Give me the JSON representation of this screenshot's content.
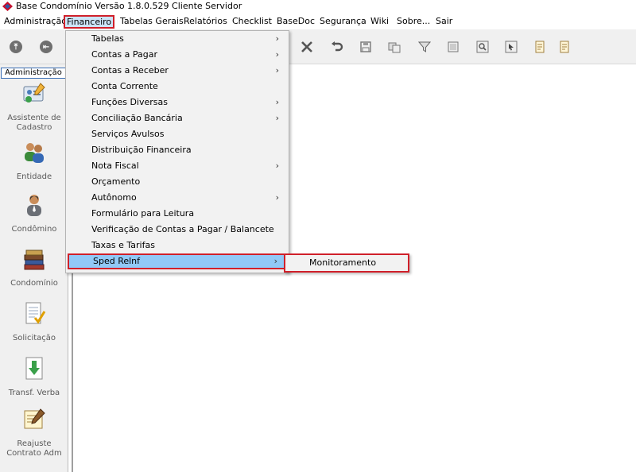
{
  "window": {
    "title": "Base Condomínio Versão 1.8.0.529 Cliente Servidor"
  },
  "menubar": {
    "items": [
      "Administração",
      "Financeiro",
      "Tabelas Gerais",
      "Relatórios",
      "Checklist",
      "BaseDoc",
      "Segurança",
      "Wiki",
      "Sobre...",
      "Sair"
    ]
  },
  "sidebar": {
    "tab": "Administração",
    "items": [
      "Assistente de Cadastro",
      "Entidade",
      "Condômino",
      "Condomínio",
      "Solicitação",
      "Transf. Verba",
      "Reajuste Contrato Adm"
    ]
  },
  "financeiro_menu": {
    "items": [
      "Tabelas",
      "Contas a Pagar",
      "Contas a Receber",
      "Conta Corrente",
      "Funções Diversas",
      "Conciliação Bancária",
      "Serviços Avulsos",
      "Distribuição Financeira",
      "Nota Fiscal",
      "Orçamento",
      "Autônomo",
      "Formulário para Leitura",
      "Verificação de Contas a Pagar / Balancete",
      "Taxas e Tarifas",
      "Sped Relnf"
    ],
    "submenu_arrow": "›"
  },
  "sped_submenu": {
    "items": [
      "Monitoramento"
    ]
  },
  "colors": {
    "highlight": "#91c9f7",
    "selection_border": "#d0202a",
    "menu_bg": "#f2f2f2",
    "toolbar_bg": "#f0f0f0"
  }
}
